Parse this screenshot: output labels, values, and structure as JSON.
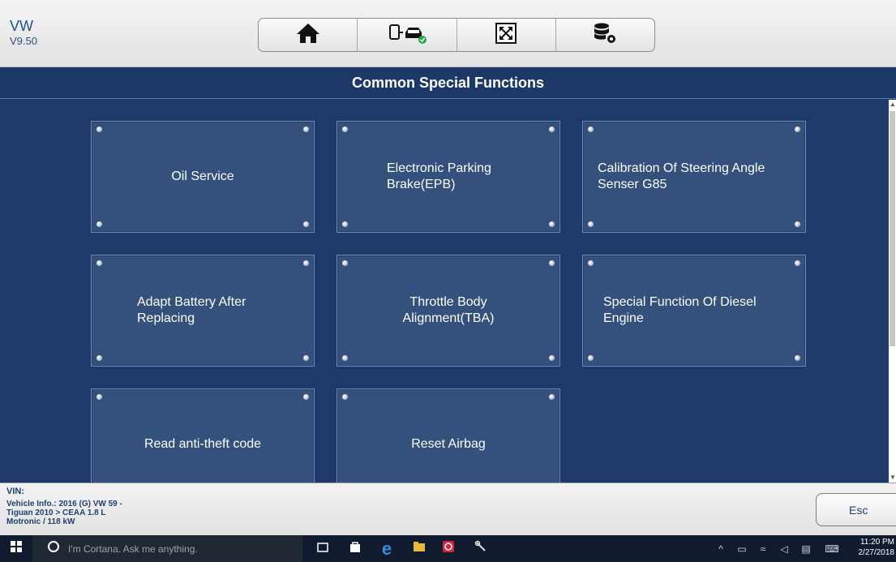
{
  "header": {
    "brand": "VW",
    "version": "V9.50",
    "toolbar": [
      {
        "name": "home-icon"
      },
      {
        "name": "vehicle-connection-icon"
      },
      {
        "name": "fullscreen-icon"
      },
      {
        "name": "data-settings-icon"
      }
    ]
  },
  "page": {
    "title": "Common Special Functions"
  },
  "tiles": [
    {
      "label": "Oil Service"
    },
    {
      "label": "Electronic Parking Brake(EPB)"
    },
    {
      "label": "Calibration Of Steering Angle Senser G85"
    },
    {
      "label": "Adapt Battery After Replacing"
    },
    {
      "label": "Throttle Body Alignment(TBA)"
    },
    {
      "label": "Special Function Of Diesel Engine"
    },
    {
      "label": "Read anti-theft code"
    },
    {
      "label": "Reset Airbag"
    }
  ],
  "footer": {
    "vin_label": "VIN:",
    "vehicle_info_line1": "Vehicle Info.: 2016 (G) VW 59 -",
    "vehicle_info_line2": "Tiguan 2010 > CEAA 1.8 L",
    "vehicle_info_line3": "Motronic / 118 kW",
    "esc_label": "Esc"
  },
  "taskbar": {
    "search_placeholder": "I'm Cortana. Ask me anything.",
    "time": "11:20 PM",
    "date": "2/27/2018"
  },
  "colors": {
    "background": "#1d3a6a",
    "tile": "#34507d",
    "accent": "#1f4f95"
  }
}
